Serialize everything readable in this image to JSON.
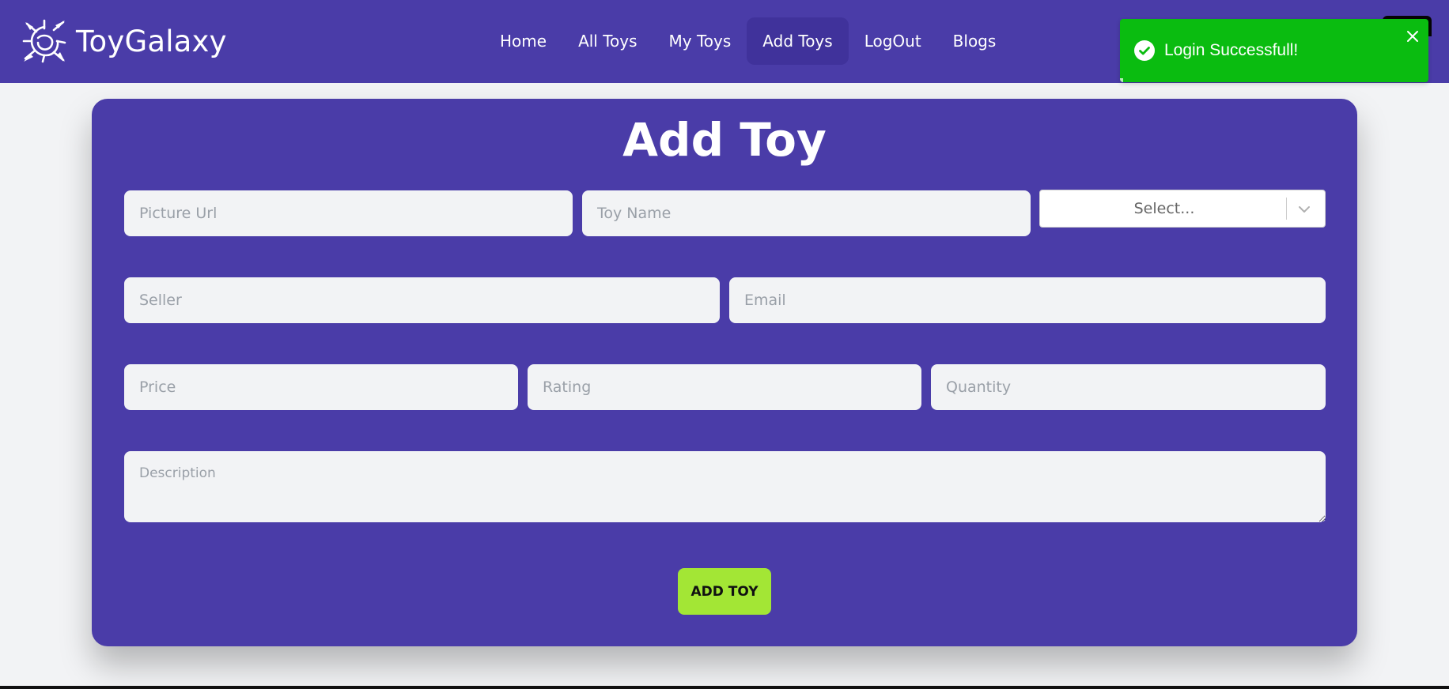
{
  "brand": {
    "name": "ToyGalaxy",
    "logo_icon": "web-spider-logo-icon"
  },
  "nav": {
    "items": [
      {
        "label": "Home"
      },
      {
        "label": "All Toys"
      },
      {
        "label": "My Toys"
      },
      {
        "label": "Add Toys",
        "active": true
      },
      {
        "label": "LogOut"
      },
      {
        "label": "Blogs"
      }
    ]
  },
  "toast": {
    "message": "Login Successfull!",
    "icon": "check-circle-icon",
    "close_icon": "close-icon",
    "color": "#0abc10"
  },
  "form": {
    "title": "Add Toy",
    "fields": {
      "picture_url": {
        "placeholder": "Picture Url",
        "value": ""
      },
      "toy_name": {
        "placeholder": "Toy Name",
        "value": ""
      },
      "category": {
        "selected": "Select..."
      },
      "seller": {
        "placeholder": "Seller",
        "value": ""
      },
      "email": {
        "placeholder": "Email",
        "value": ""
      },
      "price": {
        "placeholder": "Price",
        "value": ""
      },
      "rating": {
        "placeholder": "Rating",
        "value": ""
      },
      "quantity": {
        "placeholder": "Quantity",
        "value": ""
      },
      "description": {
        "placeholder": "Description",
        "value": ""
      }
    },
    "submit_label": "ADD TOY"
  },
  "colors": {
    "primary": "#4a3ca8",
    "accent": "#a3e635",
    "background": "#f2f3f5",
    "success": "#0abc10"
  }
}
